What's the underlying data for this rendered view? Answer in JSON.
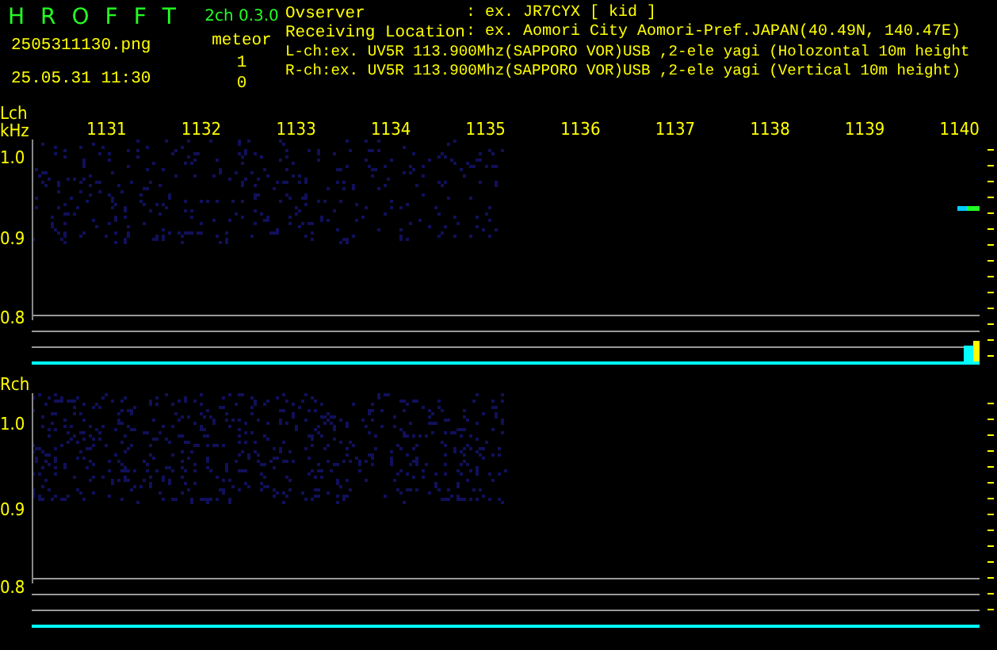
{
  "app": {
    "title_letters": [
      "H",
      "R",
      "O",
      "F",
      "F",
      "T"
    ],
    "version": "2ch 0.3.0",
    "filename": "2505311130.png",
    "timestamp": "25.05.31 11:30",
    "count_label": "meteor",
    "counts": [
      "1",
      "0"
    ]
  },
  "info": [
    {
      "label": "Ovserver",
      "value": ": ex. JR7CYX [ kid ]"
    },
    {
      "label": "Receiving Location",
      "value": ": ex. Aomori City Aomori-Pref.JAPAN(40.49N, 140.47E)"
    }
  ],
  "channel_lines": [
    "L-ch:ex. UV5R 113.900Mhz(SAPPORO VOR)USB ,2-ele yagi (Holozontal 10m height",
    "R-ch:ex. UV5R 113.900Mhz(SAPPORO VOR)USB ,2-ele yagi (Vertical 10m height)"
  ],
  "panels": [
    {
      "name": "Lch",
      "unit": "kHz",
      "freq_labels": [
        "1131",
        "1132",
        "1133",
        "1134",
        "1135",
        "1136",
        "1137",
        "1138",
        "1139",
        "1140"
      ],
      "y_labels": [
        "1.0",
        "0.9",
        "0.8"
      ],
      "echo": true
    },
    {
      "name": "Rch",
      "y_labels": [
        "1.0",
        "0.9",
        "0.8"
      ],
      "echo": false
    }
  ]
}
